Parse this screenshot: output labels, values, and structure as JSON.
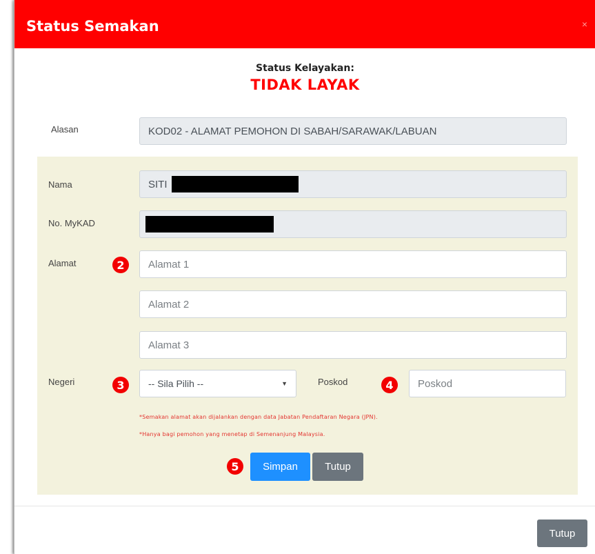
{
  "modal": {
    "title": "Status Semakan",
    "close_glyph": "×"
  },
  "status": {
    "label": "Status Kelayakan:",
    "value": "TIDAK LAYAK"
  },
  "alasan": {
    "label": "Alasan",
    "value": "KOD02 - ALAMAT PEMOHON DI SABAH/SARAWAK/LABUAN"
  },
  "form": {
    "nama_label": "Nama",
    "nama_value": "SITI",
    "mykad_label": "No. MyKAD",
    "alamat_label": "Alamat",
    "alamat1_placeholder": "Alamat 1",
    "alamat2_placeholder": "Alamat 2",
    "alamat3_placeholder": "Alamat 3",
    "negeri_label": "Negeri",
    "negeri_selected": "-- Sila Pilih --",
    "poskod_label": "Poskod",
    "poskod_placeholder": "Poskod",
    "note1": "*Semakan alamat akan dijalankan dengan data Jabatan Pendaftaran Negara (JPN).",
    "note2": "*Hanya bagi pemohon yang menetap di Semenanjung Malaysia.",
    "save_label": "Simpan",
    "close_label": "Tutup"
  },
  "badges": {
    "b2": "2",
    "b3": "3",
    "b4": "4",
    "b5": "5"
  },
  "footer": {
    "close_label": "Tutup"
  },
  "colors": {
    "header_red": "#ff0000",
    "primary_blue": "#1e90ff",
    "secondary_gray": "#6c757d",
    "panel_bg": "#f3f2dd",
    "badge_red": "#f20000"
  }
}
